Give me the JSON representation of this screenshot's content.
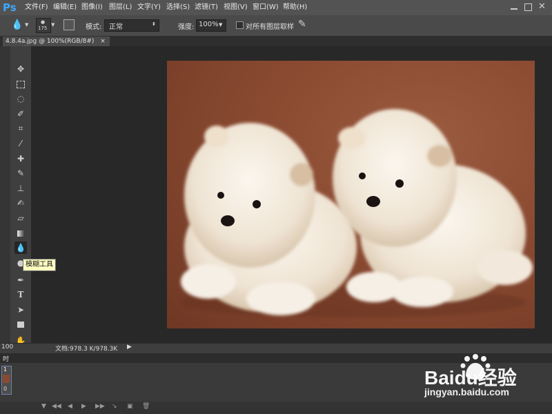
{
  "app": {
    "logo_text": "Ps",
    "menu": [
      "文件(F)",
      "编辑(E)",
      "图像(I)",
      "图层(L)",
      "文字(Y)",
      "选择(S)",
      "滤镜(T)",
      "视图(V)",
      "窗口(W)",
      "帮助(H)"
    ]
  },
  "options": {
    "brush_size": "175",
    "mode_label": "模式:",
    "mode_value": "正常",
    "strength_label": "强度:",
    "strength_value": "100%",
    "sample_all_layers_label": "对所有图层取样"
  },
  "document": {
    "tab_title": "4.8.4a.jpg @ 100%(RGB/8#)",
    "tab_close": "×"
  },
  "toolbox": {
    "tools": [
      "move",
      "marquee",
      "lasso",
      "quick-select",
      "crop",
      "eyedropper",
      "healing",
      "brush",
      "stamp",
      "history-brush",
      "eraser",
      "gradient",
      "blur",
      "dodge",
      "pen",
      "type",
      "path-select",
      "shape",
      "hand",
      "zoom"
    ],
    "tooltip": "模糊工具",
    "foreground_color": "#2000ff",
    "background_color": "#c8ff00"
  },
  "status": {
    "zoom": "100",
    "doc_size": "文档:978.3 K/978.3K"
  },
  "bottom": {
    "panel_tab": "时",
    "frame_number": "1",
    "frame_delay": "0"
  },
  "watermark": {
    "brand": "Baidu经验",
    "url": "jingyan.baidu.com"
  }
}
